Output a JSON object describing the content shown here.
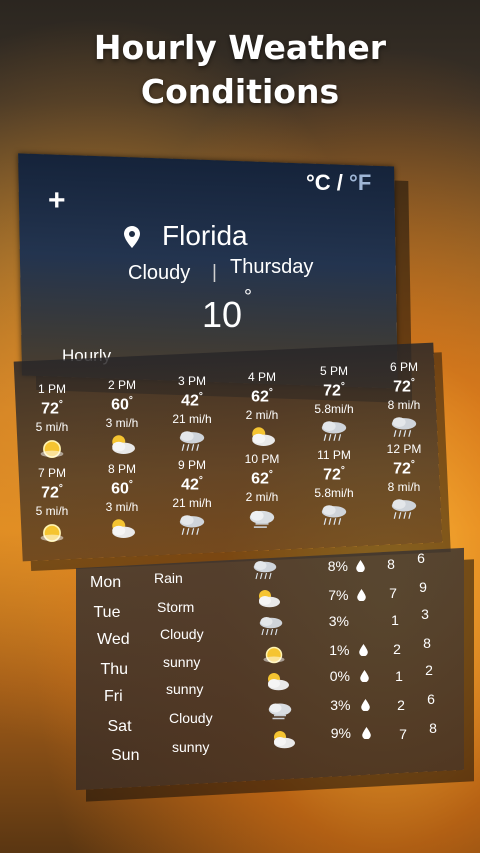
{
  "promo_title_line1": "Hourly Weather",
  "promo_title_line2": "Conditions",
  "header": {
    "add_label": "+",
    "unit_c": "°C",
    "unit_sep": " / ",
    "unit_f": "°F",
    "location": "Florida",
    "condition": "Cloudy",
    "separator": "|",
    "day": "Thursday",
    "temperature": "10",
    "degree": "°"
  },
  "hourly_label": "Hourly",
  "hourly": [
    {
      "time": "1 PM",
      "temp": "72",
      "wind": "5 mi/h",
      "icon": "sun-icon"
    },
    {
      "time": "2 PM",
      "temp": "60",
      "wind": "3 mi/h",
      "icon": "sun-cloud-icon"
    },
    {
      "time": "3 PM",
      "temp": "42",
      "wind": "21 mi/h",
      "icon": "rain-cloud-icon"
    },
    {
      "time": "4 PM",
      "temp": "62",
      "wind": "2 mi/h",
      "icon": "sun-cloud-icon"
    },
    {
      "time": "5 PM",
      "temp": "72",
      "wind": "5.8mi/h",
      "icon": "rain-cloud-icon"
    },
    {
      "time": "6 PM",
      "temp": "72",
      "wind": "8 mi/h",
      "icon": "rain-cloud-icon"
    },
    {
      "time": "7 PM",
      "temp": "72",
      "wind": "5 mi/h",
      "icon": "sun-icon"
    },
    {
      "time": "8 PM",
      "temp": "60",
      "wind": "3 mi/h",
      "icon": "sun-cloud-icon"
    },
    {
      "time": "9 PM",
      "temp": "42",
      "wind": "21 mi/h",
      "icon": "rain-cloud-icon"
    },
    {
      "time": "10 PM",
      "temp": "62",
      "wind": "2 mi/h",
      "icon": "cloud-icon"
    },
    {
      "time": "11 PM",
      "temp": "72",
      "wind": "5.8mi/h",
      "icon": "rain-cloud-icon"
    },
    {
      "time": "12 PM",
      "temp": "72",
      "wind": "8 mi/h",
      "icon": "rain-cloud-icon"
    }
  ],
  "temp_degree": "°",
  "daily": [
    {
      "day": "Mon",
      "cond": "Rain",
      "pct": "8%",
      "hi": "8",
      "lo": "6",
      "drop": true,
      "icon": "rain-cloud-icon"
    },
    {
      "day": "Tue",
      "cond": "Storm",
      "pct": "7%",
      "hi": "7",
      "lo": "9",
      "drop": true,
      "icon": "sun-cloud-icon"
    },
    {
      "day": "Wed",
      "cond": "Cloudy",
      "pct": "3%",
      "hi": "1",
      "lo": "3",
      "drop": false,
      "icon": "rain-cloud-icon"
    },
    {
      "day": "Thu",
      "cond": "sunny",
      "pct": "1%",
      "hi": "2",
      "lo": "8",
      "drop": true,
      "icon": "sun-icon"
    },
    {
      "day": "Fri",
      "cond": "sunny",
      "pct": "0%",
      "hi": "1",
      "lo": "2",
      "drop": true,
      "icon": "sun-cloud-icon"
    },
    {
      "day": "Sat",
      "cond": "Cloudy",
      "pct": "3%",
      "hi": "2",
      "lo": "6",
      "drop": true,
      "icon": "cloud-icon"
    },
    {
      "day": "Sun",
      "cond": "sunny",
      "pct": "9%",
      "hi": "7",
      "lo": "8",
      "drop": true,
      "icon": "sun-cloud-icon"
    }
  ]
}
